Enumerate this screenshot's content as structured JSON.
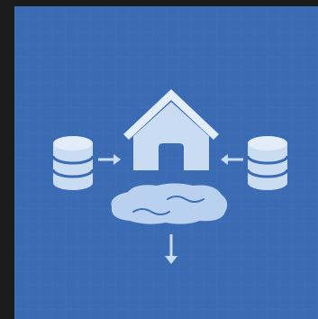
{
  "scene": {
    "description_icons": [
      "database-icon",
      "arrow-right-icon",
      "house-icon",
      "arrow-left-icon",
      "database-icon",
      "lake-icon",
      "arrow-down-icon"
    ]
  },
  "colors": {
    "outer_background": "#1c1c1d",
    "tile_background": "#3b6cb3",
    "grid_line": "#4a79bd",
    "icon_fill": "#c9dcf2",
    "icon_light": "#e2edf9",
    "icon_shadow": "#a8c4e6",
    "lake_fill": "#b9d1ee",
    "ripple": "#3f70b5"
  }
}
